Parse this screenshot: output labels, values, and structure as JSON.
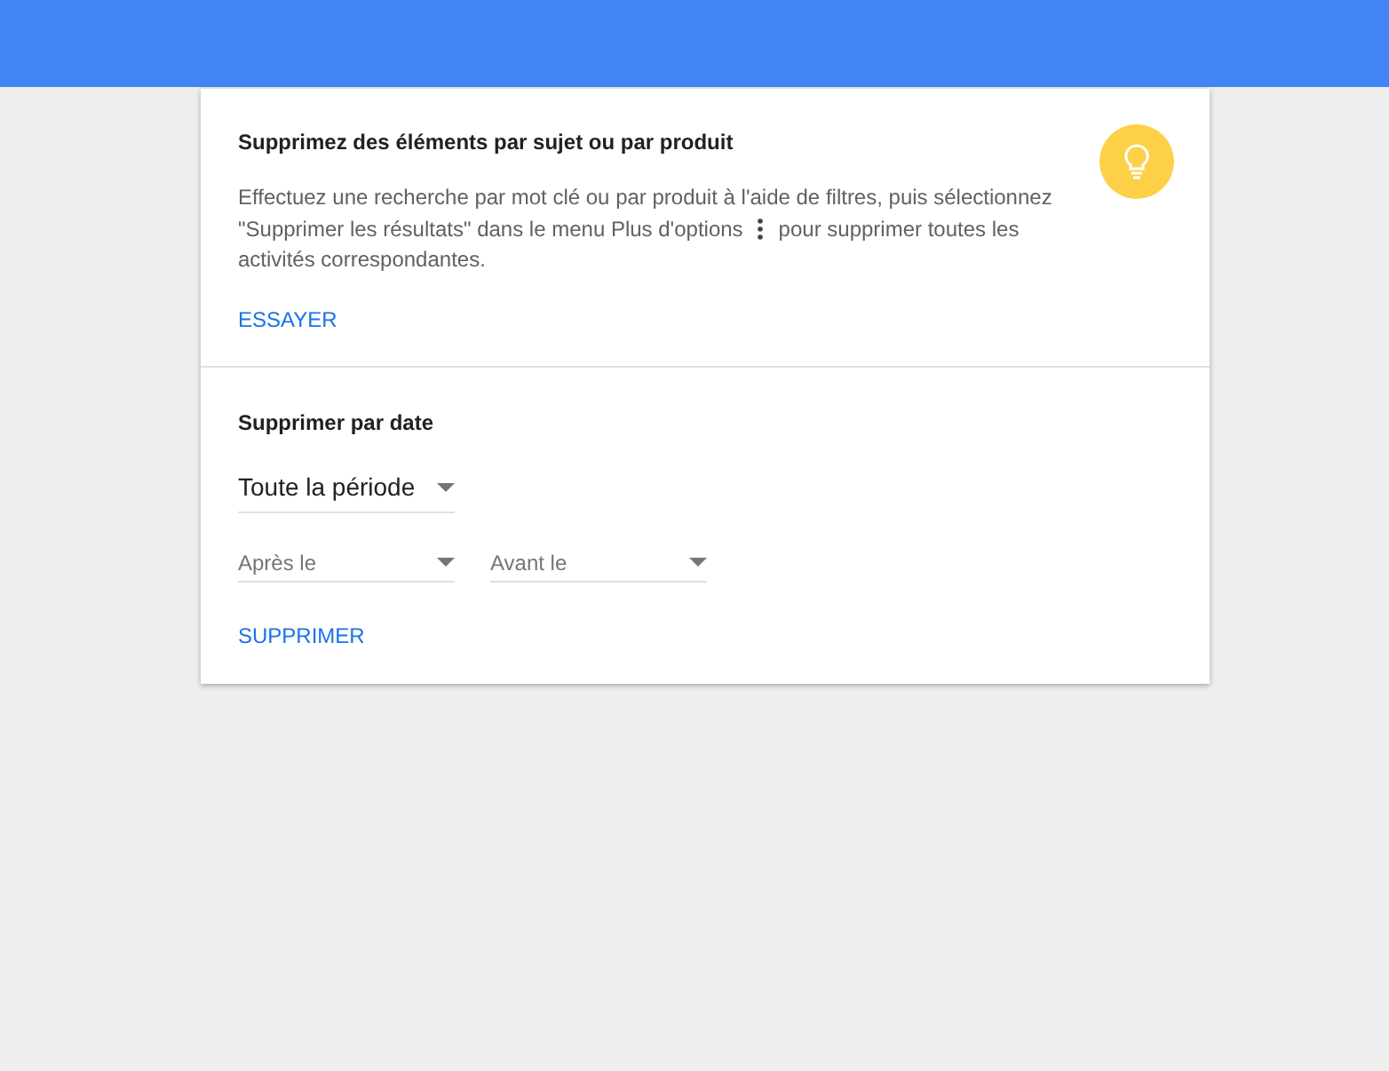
{
  "topic_card": {
    "title": "Supprimez des éléments par sujet ou par produit",
    "description_line_1": "Effectuez une recherche par mot clé ou par produit à l'aide de filtres, puis sélectionnez",
    "description_before_icon": "\"Supprimer les résultats\" dans le menu Plus d'options",
    "description_after_icon": "pour supprimer toutes les",
    "description_line_3": "activités correspondantes.",
    "action": "ESSAYER"
  },
  "date_card": {
    "title": "Supprimer par date",
    "period": "Toute la période",
    "ranges": [
      {
        "placeholder": "Après le"
      },
      {
        "placeholder": "Avant le"
      }
    ],
    "action": "SUPPRIMER"
  }
}
